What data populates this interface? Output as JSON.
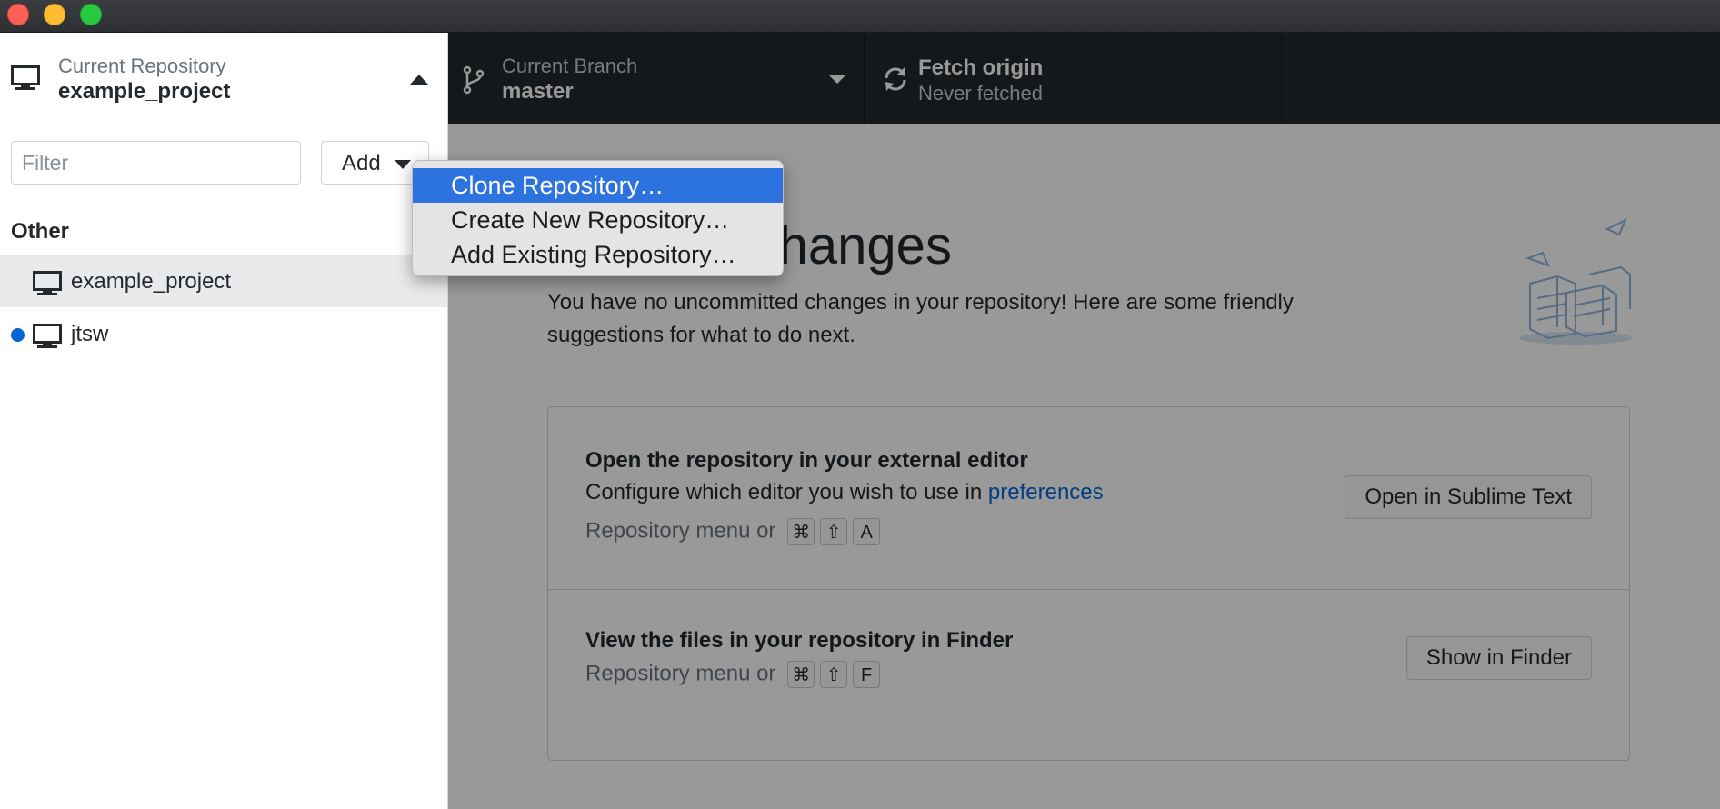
{
  "window": {
    "traffic_lights": [
      "close",
      "minimize",
      "zoom"
    ]
  },
  "sidebar": {
    "current_repository_label": "Current Repository",
    "current_repository_name": "example_project",
    "filter_placeholder": "Filter",
    "filter_value": "",
    "add_label": "Add",
    "group_title": "Other",
    "repositories": [
      {
        "name": "example_project",
        "selected": true,
        "has_changes": false
      },
      {
        "name": "jtsw",
        "selected": false,
        "has_changes": true
      }
    ]
  },
  "toolbar": {
    "branch_label": "Current Branch",
    "branch_value": "master",
    "fetch_title": "Fetch origin",
    "fetch_status": "Never fetched"
  },
  "add_menu": {
    "items": [
      {
        "label": "Clone Repository…",
        "active": true
      },
      {
        "label": "Create New Repository…",
        "active": false
      },
      {
        "label": "Add Existing Repository…",
        "active": false
      }
    ]
  },
  "main": {
    "title": "No local changes",
    "description": "You have no uncommitted changes in your repository! Here are some friendly suggestions for what to do next.",
    "actions": [
      {
        "title": "Open the repository in your external editor",
        "text_prefix": "Configure which editor you wish to use in ",
        "link": "preferences",
        "hint": "Repository menu or",
        "shortcut": [
          "⌘",
          "⇧",
          "A"
        ],
        "button": "Open in Sublime Text"
      },
      {
        "title": "View the files in your repository in Finder",
        "hint": "Repository menu or",
        "shortcut": [
          "⌘",
          "⇧",
          "F"
        ],
        "button": "Show in Finder"
      }
    ]
  },
  "colors": {
    "toolbar_bg": "#24292e",
    "menu_highlight": "#2d73e0",
    "link": "#0366d6",
    "change_dot": "#0366d6"
  }
}
